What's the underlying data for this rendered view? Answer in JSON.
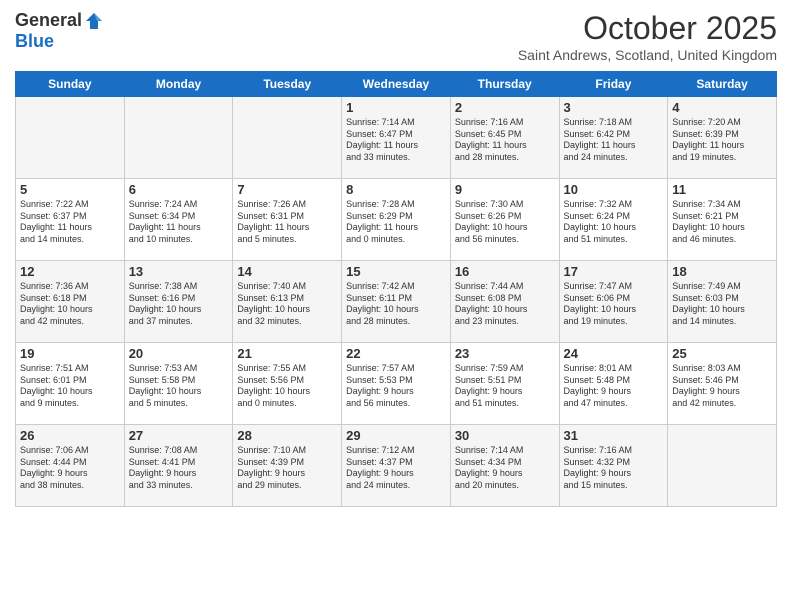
{
  "header": {
    "logo_general": "General",
    "logo_blue": "Blue",
    "month_title": "October 2025",
    "subtitle": "Saint Andrews, Scotland, United Kingdom"
  },
  "days_of_week": [
    "Sunday",
    "Monday",
    "Tuesday",
    "Wednesday",
    "Thursday",
    "Friday",
    "Saturday"
  ],
  "weeks": [
    [
      {
        "day": "",
        "content": ""
      },
      {
        "day": "",
        "content": ""
      },
      {
        "day": "",
        "content": ""
      },
      {
        "day": "1",
        "content": "Sunrise: 7:14 AM\nSunset: 6:47 PM\nDaylight: 11 hours\nand 33 minutes."
      },
      {
        "day": "2",
        "content": "Sunrise: 7:16 AM\nSunset: 6:45 PM\nDaylight: 11 hours\nand 28 minutes."
      },
      {
        "day": "3",
        "content": "Sunrise: 7:18 AM\nSunset: 6:42 PM\nDaylight: 11 hours\nand 24 minutes."
      },
      {
        "day": "4",
        "content": "Sunrise: 7:20 AM\nSunset: 6:39 PM\nDaylight: 11 hours\nand 19 minutes."
      }
    ],
    [
      {
        "day": "5",
        "content": "Sunrise: 7:22 AM\nSunset: 6:37 PM\nDaylight: 11 hours\nand 14 minutes."
      },
      {
        "day": "6",
        "content": "Sunrise: 7:24 AM\nSunset: 6:34 PM\nDaylight: 11 hours\nand 10 minutes."
      },
      {
        "day": "7",
        "content": "Sunrise: 7:26 AM\nSunset: 6:31 PM\nDaylight: 11 hours\nand 5 minutes."
      },
      {
        "day": "8",
        "content": "Sunrise: 7:28 AM\nSunset: 6:29 PM\nDaylight: 11 hours\nand 0 minutes."
      },
      {
        "day": "9",
        "content": "Sunrise: 7:30 AM\nSunset: 6:26 PM\nDaylight: 10 hours\nand 56 minutes."
      },
      {
        "day": "10",
        "content": "Sunrise: 7:32 AM\nSunset: 6:24 PM\nDaylight: 10 hours\nand 51 minutes."
      },
      {
        "day": "11",
        "content": "Sunrise: 7:34 AM\nSunset: 6:21 PM\nDaylight: 10 hours\nand 46 minutes."
      }
    ],
    [
      {
        "day": "12",
        "content": "Sunrise: 7:36 AM\nSunset: 6:18 PM\nDaylight: 10 hours\nand 42 minutes."
      },
      {
        "day": "13",
        "content": "Sunrise: 7:38 AM\nSunset: 6:16 PM\nDaylight: 10 hours\nand 37 minutes."
      },
      {
        "day": "14",
        "content": "Sunrise: 7:40 AM\nSunset: 6:13 PM\nDaylight: 10 hours\nand 32 minutes."
      },
      {
        "day": "15",
        "content": "Sunrise: 7:42 AM\nSunset: 6:11 PM\nDaylight: 10 hours\nand 28 minutes."
      },
      {
        "day": "16",
        "content": "Sunrise: 7:44 AM\nSunset: 6:08 PM\nDaylight: 10 hours\nand 23 minutes."
      },
      {
        "day": "17",
        "content": "Sunrise: 7:47 AM\nSunset: 6:06 PM\nDaylight: 10 hours\nand 19 minutes."
      },
      {
        "day": "18",
        "content": "Sunrise: 7:49 AM\nSunset: 6:03 PM\nDaylight: 10 hours\nand 14 minutes."
      }
    ],
    [
      {
        "day": "19",
        "content": "Sunrise: 7:51 AM\nSunset: 6:01 PM\nDaylight: 10 hours\nand 9 minutes."
      },
      {
        "day": "20",
        "content": "Sunrise: 7:53 AM\nSunset: 5:58 PM\nDaylight: 10 hours\nand 5 minutes."
      },
      {
        "day": "21",
        "content": "Sunrise: 7:55 AM\nSunset: 5:56 PM\nDaylight: 10 hours\nand 0 minutes."
      },
      {
        "day": "22",
        "content": "Sunrise: 7:57 AM\nSunset: 5:53 PM\nDaylight: 9 hours\nand 56 minutes."
      },
      {
        "day": "23",
        "content": "Sunrise: 7:59 AM\nSunset: 5:51 PM\nDaylight: 9 hours\nand 51 minutes."
      },
      {
        "day": "24",
        "content": "Sunrise: 8:01 AM\nSunset: 5:48 PM\nDaylight: 9 hours\nand 47 minutes."
      },
      {
        "day": "25",
        "content": "Sunrise: 8:03 AM\nSunset: 5:46 PM\nDaylight: 9 hours\nand 42 minutes."
      }
    ],
    [
      {
        "day": "26",
        "content": "Sunrise: 7:06 AM\nSunset: 4:44 PM\nDaylight: 9 hours\nand 38 minutes."
      },
      {
        "day": "27",
        "content": "Sunrise: 7:08 AM\nSunset: 4:41 PM\nDaylight: 9 hours\nand 33 minutes."
      },
      {
        "day": "28",
        "content": "Sunrise: 7:10 AM\nSunset: 4:39 PM\nDaylight: 9 hours\nand 29 minutes."
      },
      {
        "day": "29",
        "content": "Sunrise: 7:12 AM\nSunset: 4:37 PM\nDaylight: 9 hours\nand 24 minutes."
      },
      {
        "day": "30",
        "content": "Sunrise: 7:14 AM\nSunset: 4:34 PM\nDaylight: 9 hours\nand 20 minutes."
      },
      {
        "day": "31",
        "content": "Sunrise: 7:16 AM\nSunset: 4:32 PM\nDaylight: 9 hours\nand 15 minutes."
      },
      {
        "day": "",
        "content": ""
      }
    ]
  ]
}
